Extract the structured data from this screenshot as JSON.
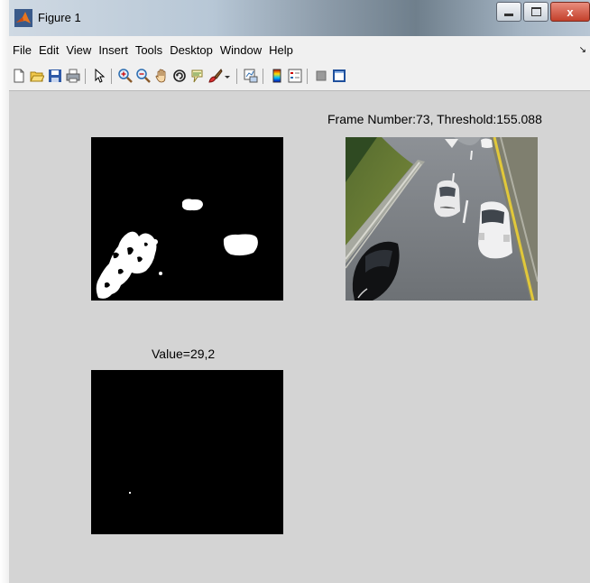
{
  "window": {
    "title": "Figure 1"
  },
  "title_controls": {
    "minimize": "",
    "maximize": "",
    "close": "x"
  },
  "menubar": {
    "items": [
      "File",
      "Edit",
      "View",
      "Insert",
      "Tools",
      "Desktop",
      "Window",
      "Help"
    ],
    "dock_glyph": "↘"
  },
  "toolbar": {
    "icons": [
      "new-figure-icon",
      "open-file-icon",
      "save-icon",
      "print-icon",
      "edit-plot-arrow-icon",
      "zoom-in-icon",
      "zoom-out-icon",
      "pan-hand-icon",
      "rotate-3d-icon",
      "data-cursor-icon",
      "brush-icon",
      "brush-dropdown-icon",
      "link-plot-icon",
      "colorbar-icon",
      "legend-icon",
      "hide-plot-tools-icon",
      "show-plot-tools-icon"
    ]
  },
  "axes": {
    "binary_mask": {
      "title": ""
    },
    "traffic_frame": {
      "title": "Frame Number:73, Threshold:155.088"
    },
    "value_mask": {
      "title": "Value=29,2"
    }
  },
  "colors": {
    "figure_bg": "#d4d4d4",
    "image_bg": "#000000",
    "mask_fg": "#ffffff"
  }
}
